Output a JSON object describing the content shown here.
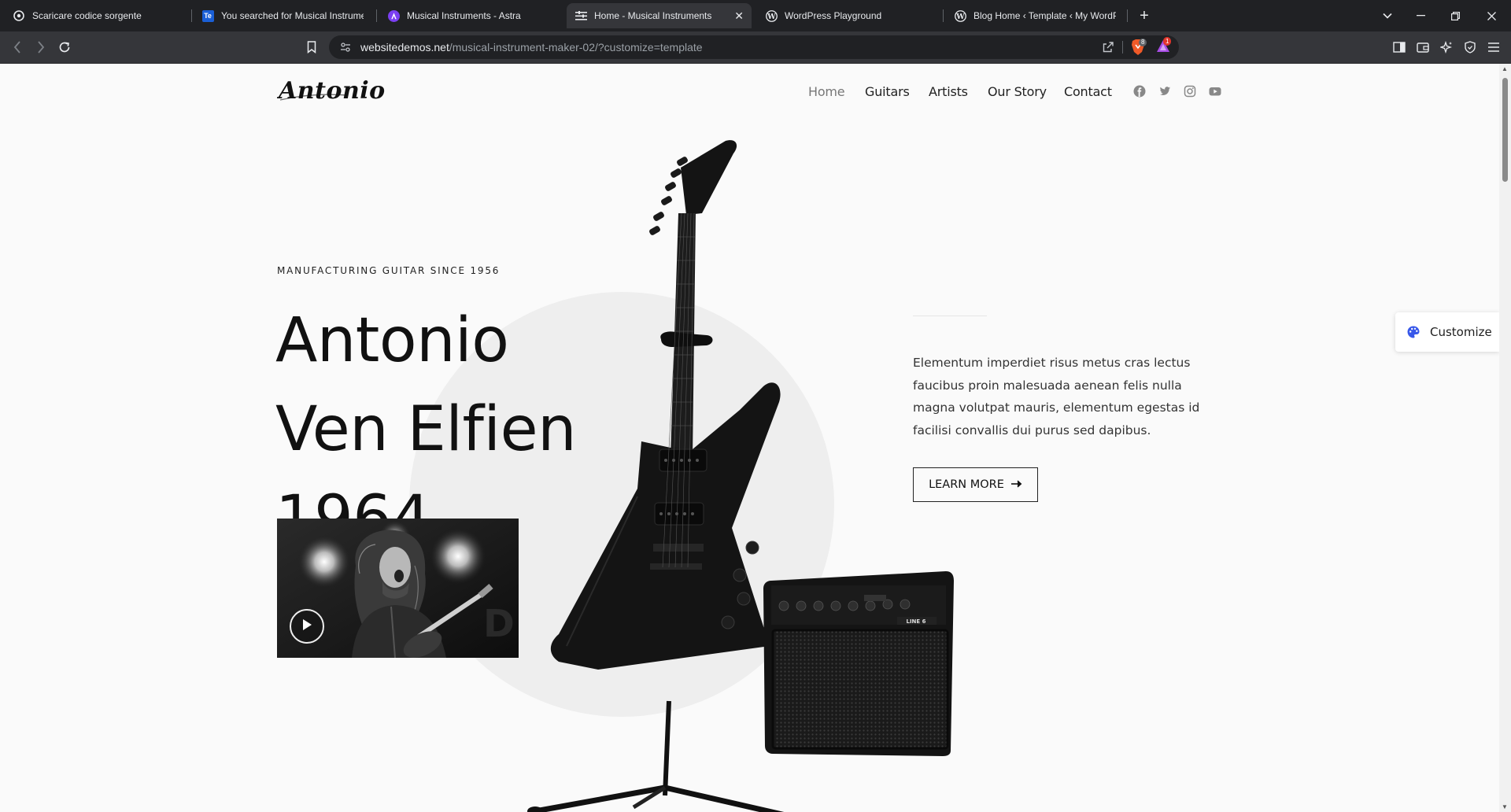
{
  "browser": {
    "tabs": [
      {
        "title": "Scaricare codice sorgente",
        "icon": "tab-favicon-circle"
      },
      {
        "title": "You searched for Musical Instrumen",
        "icon": "tab-favicon-te"
      },
      {
        "title": "Musical Instruments - Astra",
        "icon": "tab-favicon-astra"
      },
      {
        "title": "Home - Musical Instruments",
        "icon": "tab-favicon-site",
        "active": true
      },
      {
        "title": "WordPress Playground",
        "icon": "tab-favicon-wordpress"
      },
      {
        "title": "Blog Home ‹ Template ‹ My WordPr",
        "icon": "tab-favicon-wordpress"
      }
    ],
    "te_badge": "Te",
    "url_host": "websitedemos.net",
    "url_path": "/musical-instrument-maker-02/?customize=template",
    "shield_count": "8",
    "alert_count": "1"
  },
  "site": {
    "logo_text": "Antonio",
    "nav": [
      "Home",
      "Guitars",
      "Artists",
      "Our Story",
      "Contact"
    ],
    "social_icons": [
      "facebook-icon",
      "twitter-icon",
      "instagram-icon",
      "youtube-icon"
    ],
    "eyebrow": "MANUFACTURING GUITAR SINCE 1956",
    "title": "Antonio Ven Elfien 1964",
    "description": "Elementum imperdiet risus metus cras lectus faucibus proin malesuada aenean felis nulla magna volutpat mauris, elementum egestas id facilisi convallis dui purus sed dapibus.",
    "cta_label": "LEARN MORE",
    "customize_label": "Customize",
    "amp_brand": "LINE 6"
  },
  "colors": {
    "accent": "#3858e9",
    "chrome_dark": "#202124",
    "chrome_mid": "#35363a",
    "page_bg": "#fafafa",
    "text": "#111111"
  }
}
